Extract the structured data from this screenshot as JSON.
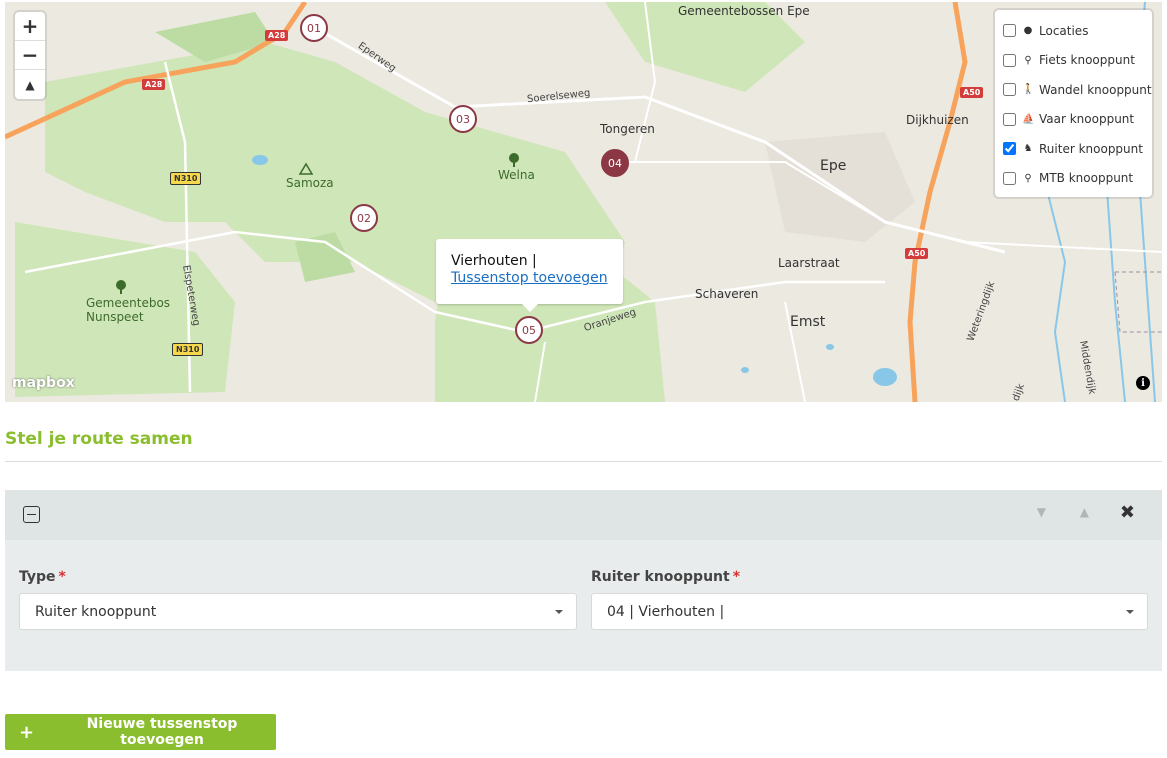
{
  "map": {
    "place_labels": [
      "Gemeentebossen Epe",
      "Tongeren",
      "Dijkhuizen",
      "Epe",
      "Samoza",
      "Welna",
      "Laarstraat",
      "Schaveren",
      "Emst",
      "Gemeentebos Nunspeet",
      "Vierhouten"
    ],
    "road_labels": [
      "Eperweg",
      "Soerelseweg",
      "Elspeterweg",
      "Oranjeweg",
      "Weteringdijk",
      "Middendijk",
      "dijk"
    ],
    "shields": [
      "A28",
      "A28",
      "N310",
      "N310",
      "A50",
      "A50"
    ],
    "nodes": [
      "01",
      "02",
      "03",
      "04",
      "05"
    ],
    "zoom_in": "+",
    "zoom_out": "−",
    "compass": "▲",
    "attribution_logo": "mapbox",
    "info": "i",
    "colors": {
      "forest": "#cfe6b8",
      "land": "#ece9e1",
      "highway": "#f7a35c",
      "water": "#88c7e8",
      "node": "#8b3844"
    }
  },
  "layers": [
    {
      "label": "Locaties",
      "icon": "pin-icon",
      "glyph": "●",
      "checked": false
    },
    {
      "label": "Fiets knooppunt",
      "icon": "bike-icon",
      "glyph": "⚲",
      "checked": false
    },
    {
      "label": "Wandel knooppunt",
      "icon": "walk-icon",
      "glyph": "🚶",
      "checked": false
    },
    {
      "label": "Vaar knooppunt",
      "icon": "boat-icon",
      "glyph": "⛵",
      "checked": false
    },
    {
      "label": "Ruiter knooppunt",
      "icon": "horse-icon",
      "glyph": "♞",
      "checked": true
    },
    {
      "label": "MTB knooppunt",
      "icon": "mtb-icon",
      "glyph": "⚲",
      "checked": false
    }
  ],
  "popup": {
    "title": "Vierhouten |",
    "link": "Tussenstop toevoegen"
  },
  "form": {
    "title": "Stel je route samen",
    "type_label": "Type",
    "type_value": "Ruiter knooppunt",
    "node_label": "Ruiter knooppunt",
    "node_value": "04 | Vierhouten |",
    "required_mark": "*",
    "close_glyph": "✖",
    "down_glyph": "▼",
    "up_glyph": "▲",
    "add_button": "Nieuwe tussenstop toevoegen",
    "add_glyph": "+"
  }
}
